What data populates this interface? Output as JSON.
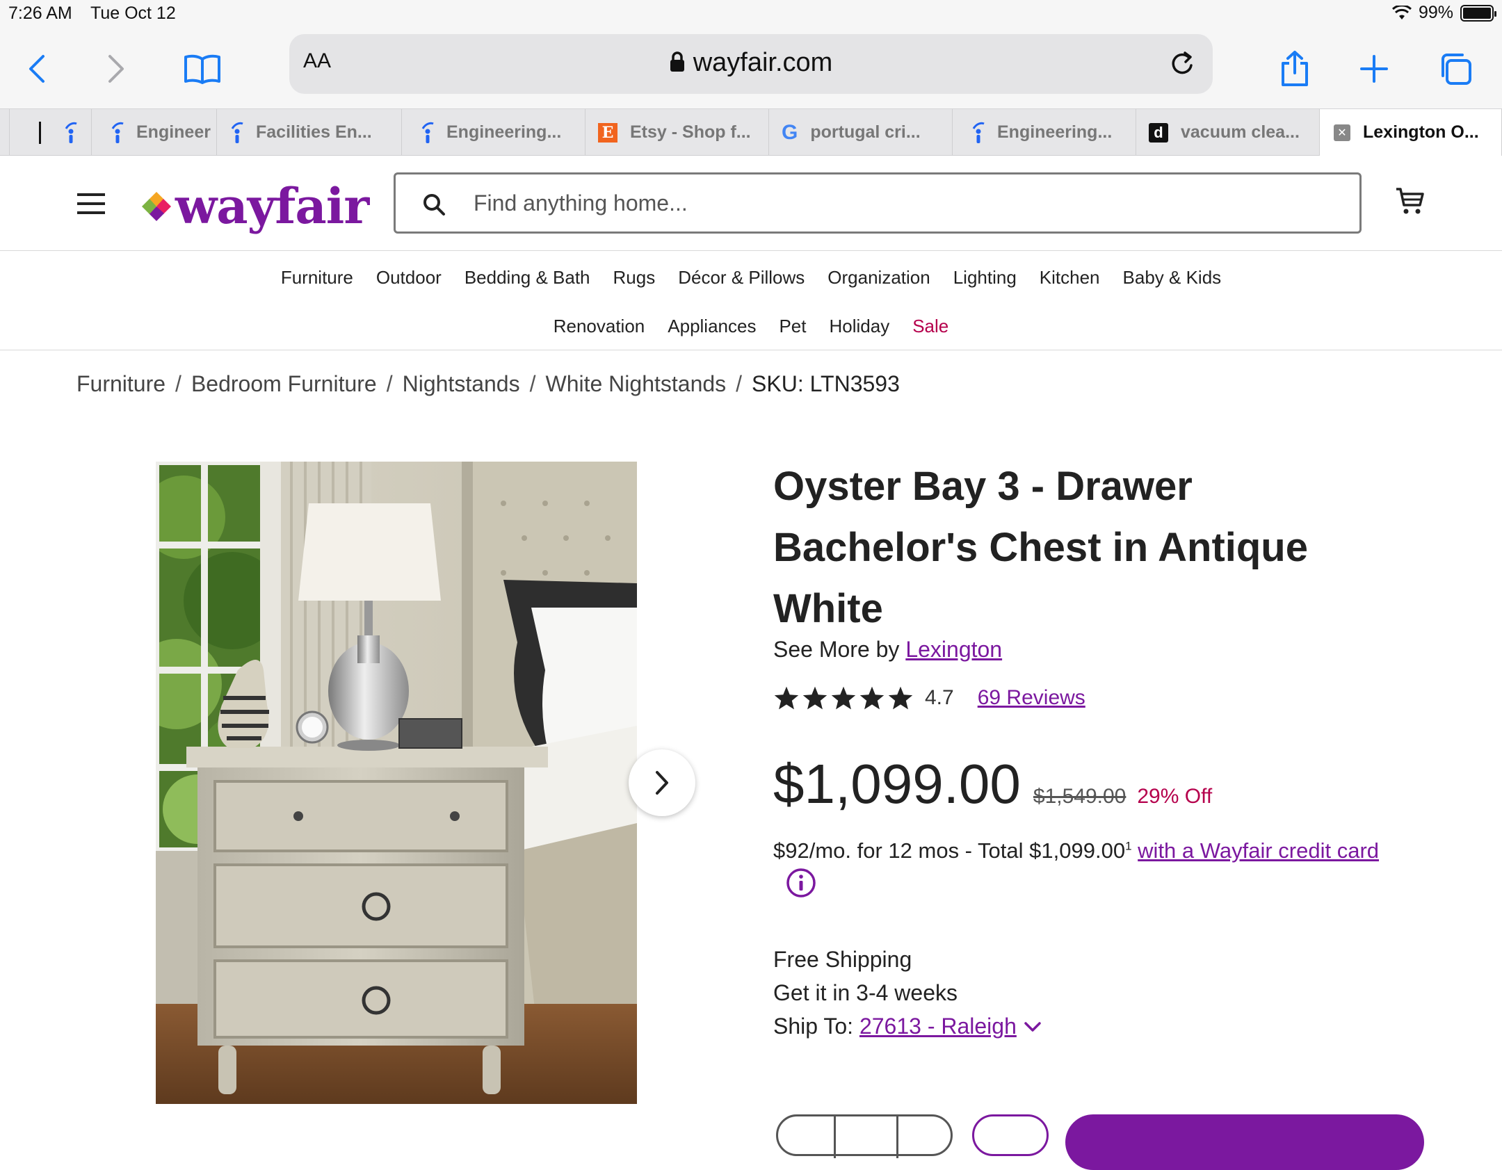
{
  "status_bar": {
    "time": "7:26 AM",
    "date": "Tue Oct 12",
    "battery": "99%"
  },
  "browser": {
    "text_size_label": "AA",
    "url": "wayfair.com",
    "tabs": [
      {
        "title": "",
        "icon": "ipad-cursor"
      },
      {
        "title": "",
        "icon": "indeed-icon"
      },
      {
        "title": "Engineer",
        "icon": "indeed-icon"
      },
      {
        "title": "Facilities En...",
        "icon": "indeed-icon"
      },
      {
        "title": "Engineering...",
        "icon": "indeed-icon"
      },
      {
        "title": "Etsy - Shop f...",
        "icon": "etsy-icon"
      },
      {
        "title": "portugal cri...",
        "icon": "google-icon"
      },
      {
        "title": "Engineering...",
        "icon": "indeed-icon"
      },
      {
        "title": "vacuum clea...",
        "icon": "tiktok-icon"
      },
      {
        "title": "Lexington O...",
        "icon": "close-tab-icon",
        "active": true
      }
    ]
  },
  "site": {
    "logo_text": "wayfair",
    "search_placeholder": "Find anything home...",
    "nav_row1": [
      "Furniture",
      "Outdoor",
      "Bedding & Bath",
      "Rugs",
      "Décor & Pillows",
      "Organization",
      "Lighting",
      "Kitchen",
      "Baby & Kids"
    ],
    "nav_row2": [
      "Renovation",
      "Appliances",
      "Pet",
      "Holiday",
      "Sale"
    ],
    "colors": {
      "brand": "#7b189f",
      "sale": "#b5004c"
    }
  },
  "breadcrumb": [
    "Furniture",
    "Bedroom Furniture",
    "Nightstands",
    "White Nightstands"
  ],
  "sku": "SKU: LTN3593",
  "product": {
    "title": "Oyster Bay 3 - Drawer Bachelor's Chest in Antique White",
    "see_more_prefix": "See More by",
    "brand": "Lexington",
    "rating": "4.7",
    "stars": 5,
    "reviews": "69 Reviews",
    "price": "$1,099.00",
    "was_price": "$1,549.00",
    "discount": "29% Off",
    "finance_text": "$92/mo. for 12 mos - Total $1,099.00",
    "finance_sup": "1",
    "finance_link": "with a Wayfair credit card",
    "shipping": "Free Shipping",
    "delivery": "Get it in 3-4 weeks",
    "ship_to_label": "Ship To:",
    "ship_to_location": "27613 - Raleigh"
  }
}
